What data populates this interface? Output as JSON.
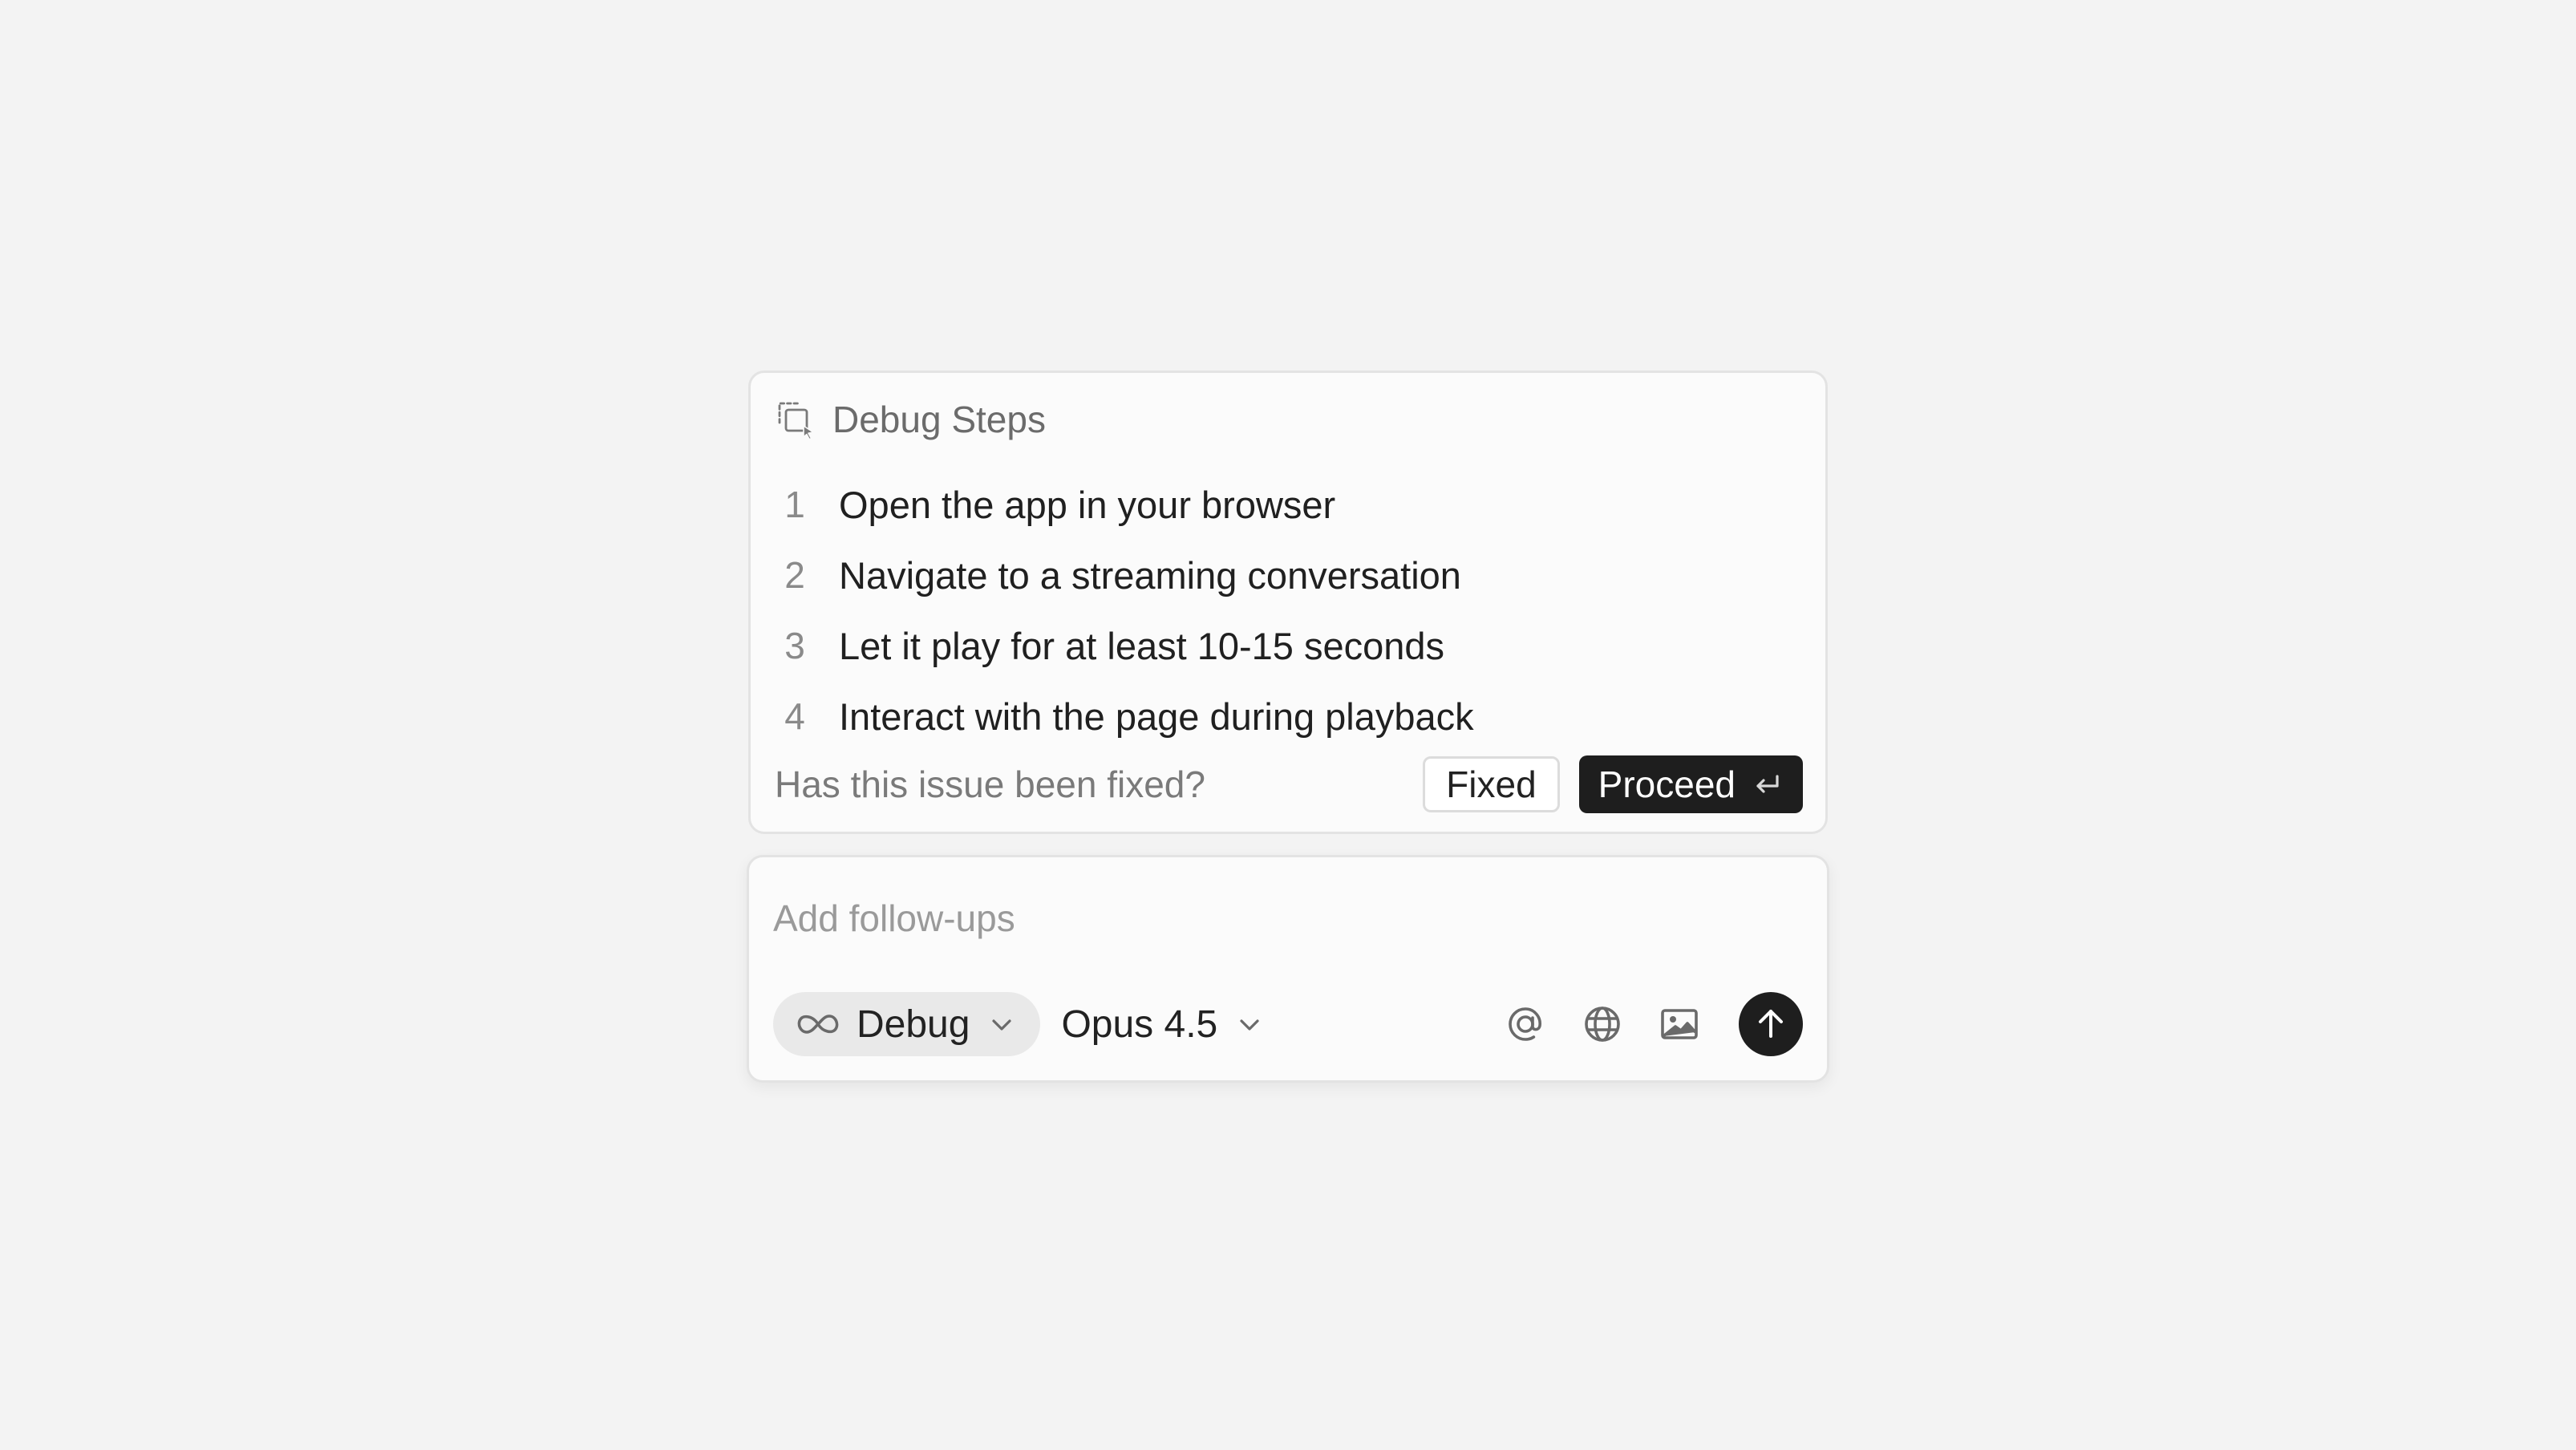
{
  "debug_steps": {
    "icon": "select-area-cursor-icon",
    "title": "Debug Steps",
    "steps": [
      {
        "number": "1",
        "text": "Open the app in your browser"
      },
      {
        "number": "2",
        "text": "Navigate to a streaming conversation"
      },
      {
        "number": "3",
        "text": "Let it play for at least 10-15 seconds"
      },
      {
        "number": "4",
        "text": "Interact with the page during playback"
      }
    ],
    "question": "Has this issue been fixed?",
    "fixed_label": "Fixed",
    "proceed_label": "Proceed",
    "proceed_icon": "enter-key-icon"
  },
  "composer": {
    "placeholder": "Add follow-ups",
    "value": "",
    "mode": {
      "icon": "infinity-icon",
      "label": "Debug"
    },
    "model": {
      "label": "Opus 4.5"
    },
    "tools": [
      "at-mention-icon",
      "globe-icon",
      "image-icon"
    ],
    "send_icon": "arrow-up-icon"
  },
  "colors": {
    "background": "#f3f3f3",
    "card": "#fbfbfb",
    "border": "#e3e3e3",
    "primary_button": "#1e1e1e",
    "mode_pill": "#e9e9e9"
  }
}
